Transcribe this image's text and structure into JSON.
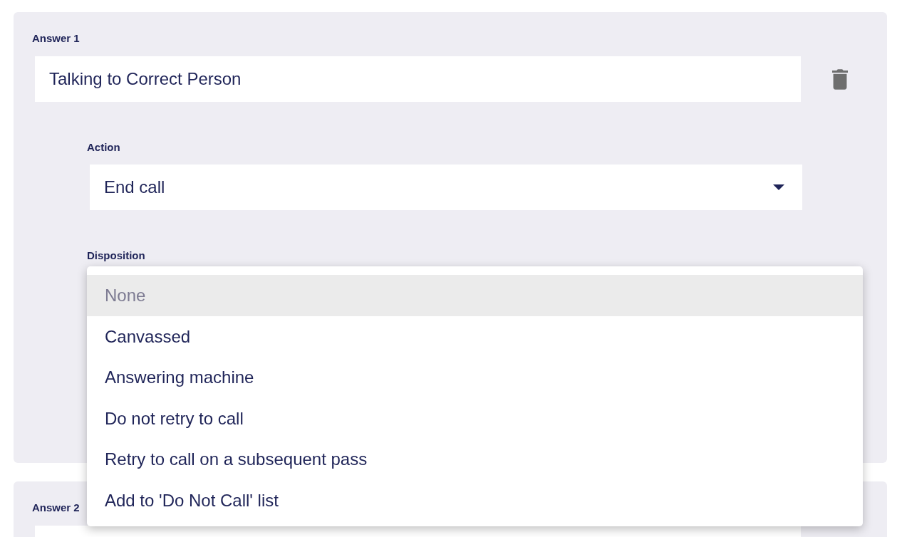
{
  "answers": [
    {
      "label": "Answer 1",
      "value": "Talking to Correct Person",
      "action": {
        "label": "Action",
        "value": "End call"
      },
      "disposition": {
        "label": "Disposition"
      }
    },
    {
      "label": "Answer 2"
    }
  ],
  "disposition_menu": {
    "options": [
      {
        "label": "None",
        "kind": "empty",
        "selected": true
      },
      {
        "label": "Canvassed",
        "kind": "option",
        "selected": false
      },
      {
        "label": "Answering machine",
        "kind": "option",
        "selected": false
      },
      {
        "label": "Do not retry to call",
        "kind": "option",
        "selected": false
      },
      {
        "label": "Retry to call on a subsequent pass",
        "kind": "option",
        "selected": false
      },
      {
        "label": "Add to 'Do Not Call' list",
        "kind": "option",
        "selected": false
      }
    ]
  }
}
